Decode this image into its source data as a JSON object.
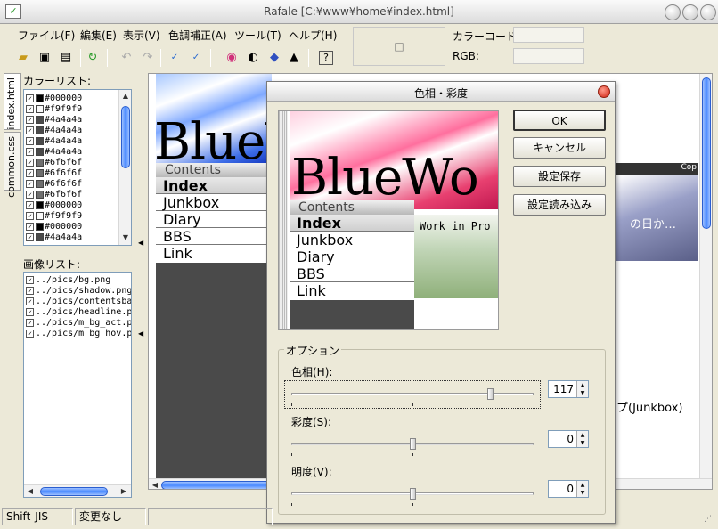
{
  "window": {
    "title": "Rafale [C:¥www¥home¥index.html]"
  },
  "menu": [
    "ファイル(F)",
    "編集(E)",
    "表示(V)",
    "色調補正(A)",
    "ツール(T)",
    "ヘルプ(H)"
  ],
  "toolbar_icons": [
    "open-folder-icon",
    "save-icon",
    "save-all-icon",
    "refresh-icon",
    "undo-icon",
    "redo-icon",
    "check-all-icon",
    "check-invert-icon",
    "color-wheel-icon",
    "contrast-icon",
    "palette-icon",
    "hat-icon",
    "help-icon"
  ],
  "color_panel": {
    "swatch_symbol": "□",
    "color_code_label": "カラーコード:",
    "color_code_value": "",
    "rgb_label": "RGB:",
    "rgb_value": ""
  },
  "side_tabs": [
    "index.html",
    "common.css"
  ],
  "color_list": {
    "label": "カラーリスト:",
    "items": [
      {
        "hex": "#000000",
        "color": "#000000"
      },
      {
        "hex": "#f9f9f9",
        "color": "#f9f9f9"
      },
      {
        "hex": "#4a4a4a",
        "color": "#4a4a4a"
      },
      {
        "hex": "#4a4a4a",
        "color": "#4a4a4a"
      },
      {
        "hex": "#4a4a4a",
        "color": "#4a4a4a"
      },
      {
        "hex": "#4a4a4a",
        "color": "#4a4a4a"
      },
      {
        "hex": "#6f6f6f",
        "color": "#6f6f6f"
      },
      {
        "hex": "#6f6f6f",
        "color": "#6f6f6f"
      },
      {
        "hex": "#6f6f6f",
        "color": "#6f6f6f"
      },
      {
        "hex": "#6f6f6f",
        "color": "#6f6f6f"
      },
      {
        "hex": "#000000",
        "color": "#000000"
      },
      {
        "hex": "#f9f9f9",
        "color": "#f9f9f9"
      },
      {
        "hex": "#000000",
        "color": "#000000"
      },
      {
        "hex": "#4a4a4a",
        "color": "#4a4a4a"
      }
    ]
  },
  "image_list": {
    "label": "画像リスト:",
    "items": [
      "../pics/bg.png",
      "../pics/shadow.png",
      "../pics/contentsbar.p",
      "../pics/headline.png",
      "../pics/m_bg_act.png",
      "../pics/m_bg_hov.png"
    ]
  },
  "page_preview": {
    "logo": "BlueWo",
    "contents_header": "Contents",
    "nav": [
      "Index",
      "Junkbox",
      "Diary",
      "BBS",
      "Link"
    ],
    "banner_label": "Cop",
    "banner_text": "の日か…",
    "body_text": "プ(Junkbox)"
  },
  "dialog": {
    "title": "色相・彩度",
    "buttons": {
      "ok": "OK",
      "cancel": "キャンセル",
      "save": "設定保存",
      "load": "設定読み込み"
    },
    "preview": {
      "logo": "BlueWo",
      "contents_header": "Contents",
      "nav": [
        "Index",
        "Junkbox",
        "Diary",
        "BBS",
        "Link"
      ],
      "work_text": "Work in Pro"
    },
    "options_label": "オプション",
    "sliders": [
      {
        "label": "色相(H):",
        "value": "117",
        "fraction": 0.82
      },
      {
        "label": "彩度(S):",
        "value": "0",
        "fraction": 0.5
      },
      {
        "label": "明度(V):",
        "value": "0",
        "fraction": 0.5
      }
    ]
  },
  "status": {
    "encoding": "Shift-JIS",
    "state": "変更なし",
    "cell3": ""
  }
}
